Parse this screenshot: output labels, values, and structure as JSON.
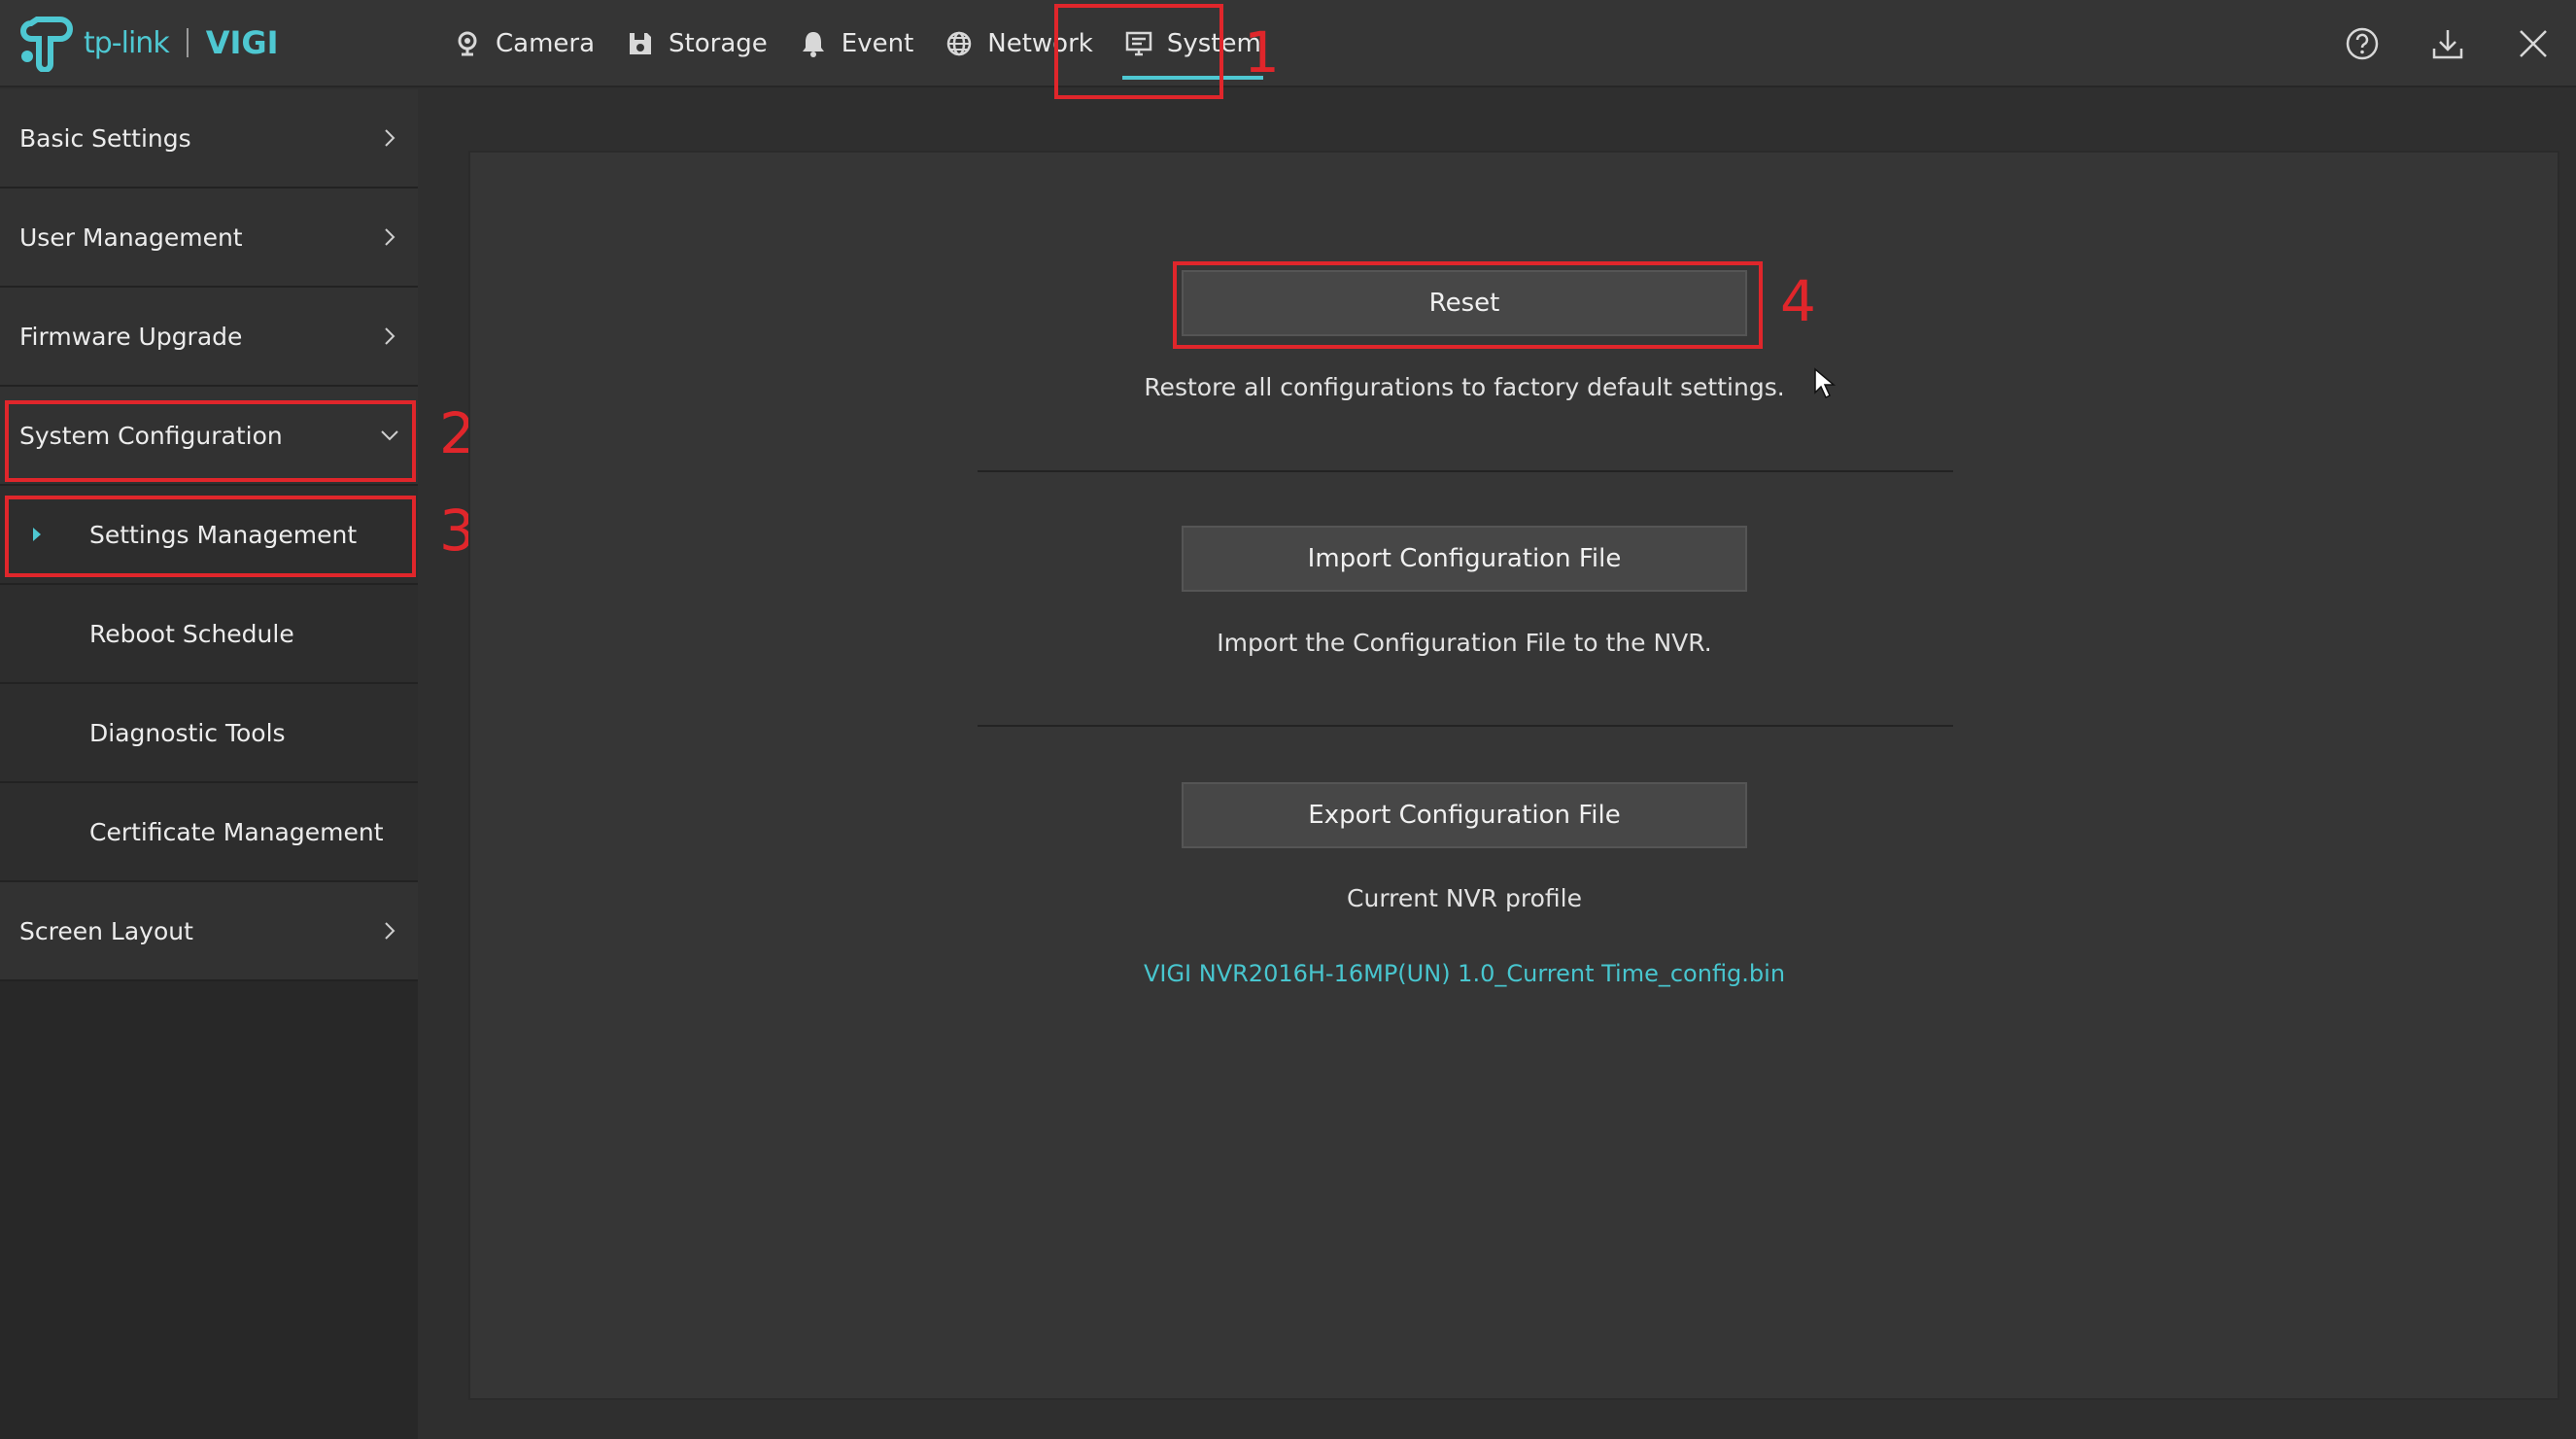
{
  "brand": {
    "logo": "tp-link",
    "product": "VIGI"
  },
  "nav": [
    {
      "label": "Camera",
      "icon": "camera-icon"
    },
    {
      "label": "Storage",
      "icon": "storage-icon"
    },
    {
      "label": "Event",
      "icon": "bell-icon"
    },
    {
      "label": "Network",
      "icon": "globe-icon"
    },
    {
      "label": "System",
      "icon": "monitor-icon",
      "active": true
    }
  ],
  "top_icons": [
    "help-icon",
    "download-icon",
    "close-icon"
  ],
  "sidebar": {
    "basic_settings": "Basic Settings",
    "user_management": "User Management",
    "firmware_upgrade": "Firmware Upgrade",
    "system_configuration": "System Configuration",
    "sub": {
      "settings_management": "Settings Management",
      "reboot_schedule": "Reboot Schedule",
      "diagnostic_tools": "Diagnostic Tools",
      "certificate_management": "Certificate Management"
    },
    "screen_layout": "Screen Layout"
  },
  "main": {
    "reset_label": "Reset",
    "reset_desc": "Restore all configurations to factory default settings.",
    "import_label": "Import Configuration File",
    "import_desc": "Import the Configuration File to the NVR.",
    "export_label": "Export Configuration File",
    "export_desc": "Current NVR profile",
    "profile_file": "VIGI NVR2016H-16MP(UN) 1.0_Current Time_config.bin"
  },
  "annotations": [
    "1",
    "2",
    "3",
    "4"
  ],
  "colors": {
    "accent": "#4ec8d2",
    "annotation": "#e0262b"
  }
}
